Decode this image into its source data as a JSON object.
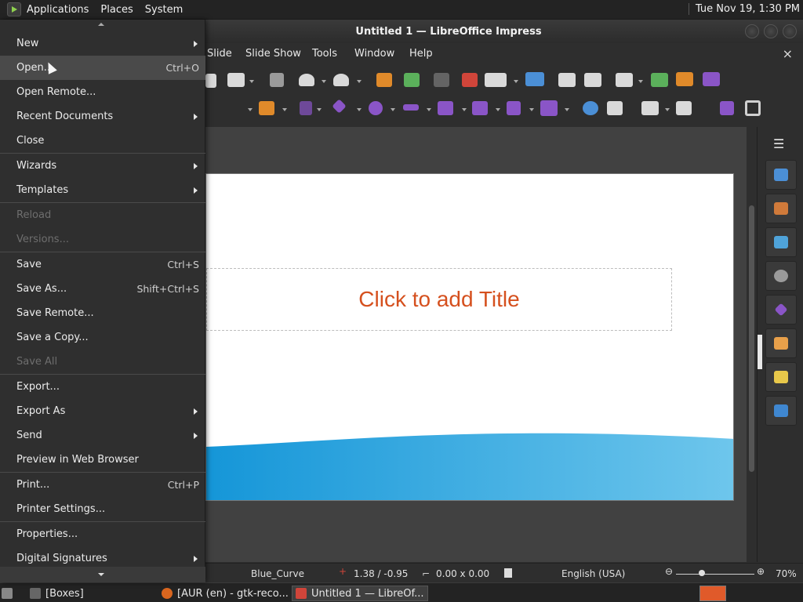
{
  "top_panel": {
    "menus": [
      "Applications",
      "Places",
      "System"
    ],
    "clock": "Tue Nov 19,  1:30 PM"
  },
  "window": {
    "title": "Untitled 1 — LibreOffice Impress",
    "menubar": [
      "Slide",
      "Slide Show",
      "Tools",
      "Window",
      "Help"
    ],
    "close_doc": "×"
  },
  "slide": {
    "title_placeholder": "Click to add Title",
    "wave_color": "#2ea3df"
  },
  "sidebar": {
    "menu_glyph": "☰",
    "buttons": [
      "properties-icon",
      "styles-icon",
      "gallery-icon",
      "navigator-icon",
      "shapes-icon",
      "slide-transition-icon",
      "animation-icon",
      "master-slides-icon"
    ]
  },
  "statusbar": {
    "master": "Blue_Curve",
    "position": "1.38 / -0.95",
    "size": "0.00 x 0.00",
    "language": "English (USA)",
    "zoom": "70%"
  },
  "taskbar": {
    "tasks": [
      "[Boxes]",
      "[AUR (en) - gtk-reco...",
      "Untitled 1 — LibreOf..."
    ]
  },
  "file_menu": {
    "items": [
      {
        "label": "New",
        "accel": "",
        "submenu": true,
        "disabled": false
      },
      {
        "label": "Open...",
        "accel": "Ctrl+O",
        "submenu": false,
        "disabled": false
      },
      {
        "label": "Open Remote...",
        "accel": "",
        "submenu": false,
        "disabled": false
      },
      {
        "label": "Recent Documents",
        "accel": "",
        "submenu": true,
        "disabled": false
      },
      {
        "label": "Close",
        "accel": "",
        "submenu": false,
        "disabled": false
      },
      {
        "label": "Wizards",
        "accel": "",
        "submenu": true,
        "disabled": false
      },
      {
        "label": "Templates",
        "accel": "",
        "submenu": true,
        "disabled": false
      },
      {
        "label": "Reload",
        "accel": "",
        "submenu": false,
        "disabled": true
      },
      {
        "label": "Versions...",
        "accel": "",
        "submenu": false,
        "disabled": true
      },
      {
        "label": "Save",
        "accel": "Ctrl+S",
        "submenu": false,
        "disabled": false
      },
      {
        "label": "Save As...",
        "accel": "Shift+Ctrl+S",
        "submenu": false,
        "disabled": false
      },
      {
        "label": "Save Remote...",
        "accel": "",
        "submenu": false,
        "disabled": false
      },
      {
        "label": "Save a Copy...",
        "accel": "",
        "submenu": false,
        "disabled": false
      },
      {
        "label": "Save All",
        "accel": "",
        "submenu": false,
        "disabled": true
      },
      {
        "label": "Export...",
        "accel": "",
        "submenu": false,
        "disabled": false
      },
      {
        "label": "Export As",
        "accel": "",
        "submenu": true,
        "disabled": false
      },
      {
        "label": "Send",
        "accel": "",
        "submenu": true,
        "disabled": false
      },
      {
        "label": "Preview in Web Browser",
        "accel": "",
        "submenu": false,
        "disabled": false
      },
      {
        "label": "Print...",
        "accel": "Ctrl+P",
        "submenu": false,
        "disabled": false
      },
      {
        "label": "Printer Settings...",
        "accel": "",
        "submenu": false,
        "disabled": false
      },
      {
        "label": "Properties...",
        "accel": "",
        "submenu": false,
        "disabled": false
      },
      {
        "label": "Digital Signatures",
        "accel": "",
        "submenu": true,
        "disabled": false
      }
    ]
  }
}
